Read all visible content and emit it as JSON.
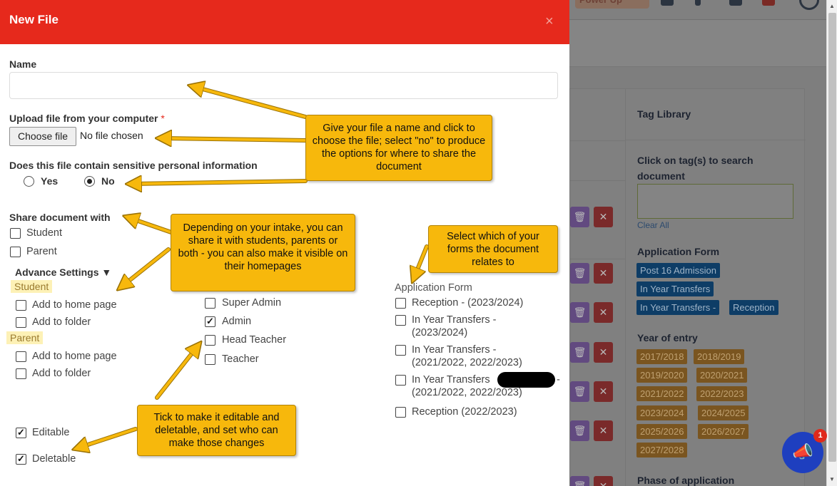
{
  "background": {
    "topbar": {
      "powerup_label": "Power Up"
    },
    "tag_library": {
      "title": "Tag Library",
      "search_label": "Click on tag(s) to search document",
      "clear_all": "Clear All",
      "application_form_title": "Application Form",
      "application_form_tags": [
        "Post 16 Admission",
        "In Year Transfers",
        "In Year Transfers -",
        "Reception"
      ],
      "year_of_entry_title": "Year of entry",
      "year_tags": [
        "2017/2018",
        "2018/2019",
        "2019/2020",
        "2020/2021",
        "2021/2022",
        "2022/2023",
        "2023/2024",
        "2024/2025",
        "2025/2026",
        "2026/2027",
        "2027/2028"
      ],
      "phase_title": "Phase of application"
    },
    "notification_count": "1"
  },
  "modal": {
    "title": "New File",
    "close": "×",
    "name_label": "Name",
    "name_value": "",
    "upload_label": "Upload file from your computer",
    "required_mark": "*",
    "choose_file": "Choose file",
    "no_file": "No file chosen",
    "sensitive_label": "Does this file contain sensitive personal information",
    "yes": "Yes",
    "no": "No",
    "share_label": "Share document with",
    "share_options": [
      {
        "label": "Student",
        "checked": false
      },
      {
        "label": "Parent",
        "checked": false
      }
    ],
    "advance_settings": "Advance Settings ▼",
    "student_heading": "Student",
    "parent_heading": "Parent",
    "student_options": [
      {
        "label": "Add to home page",
        "checked": false
      },
      {
        "label": "Add to folder",
        "checked": false
      }
    ],
    "parent_options": [
      {
        "label": "Add to home page",
        "checked": false
      },
      {
        "label": "Add to folder",
        "checked": false
      }
    ],
    "roles": [
      {
        "label": "Super Admin",
        "checked": false
      },
      {
        "label": "Admin",
        "checked": true
      },
      {
        "label": "Head Teacher",
        "checked": false
      },
      {
        "label": "Teacher",
        "checked": false
      }
    ],
    "application_form_title": "Application Form",
    "application_forms": [
      {
        "line1": "Reception - (2023/2024)",
        "line2": "",
        "checked": false
      },
      {
        "line1": "In Year Transfers -",
        "line2": "(2023/2024)",
        "checked": false
      },
      {
        "line1": "In Year Transfers -",
        "line2": "(2021/2022, 2022/2023)",
        "checked": false
      },
      {
        "line1": "In Year Transfers",
        "suffix": "-",
        "line2": "(2021/2022, 2022/2023)",
        "checked": false
      },
      {
        "line1": "Reception (2022/2023)",
        "line2": "",
        "checked": false
      }
    ],
    "editable": {
      "label": "Editable",
      "checked": true
    },
    "deletable": {
      "label": "Deletable",
      "checked": true
    }
  },
  "callouts": {
    "name_file": "Give your file a name and click to choose the file; select \"no\" to produce the options for where to share the document",
    "share": "Depending on your intake, you can share it with students, parents or both - you can also make it visible on their homepages",
    "forms": "Select which of your forms the document relates to",
    "edit": "Tick to make it editable and deletable, and set who can make those changes"
  },
  "colors": {
    "header_red": "#e6291c",
    "callout_yellow": "#f7b80c",
    "highlight": "#fdf1b6"
  }
}
